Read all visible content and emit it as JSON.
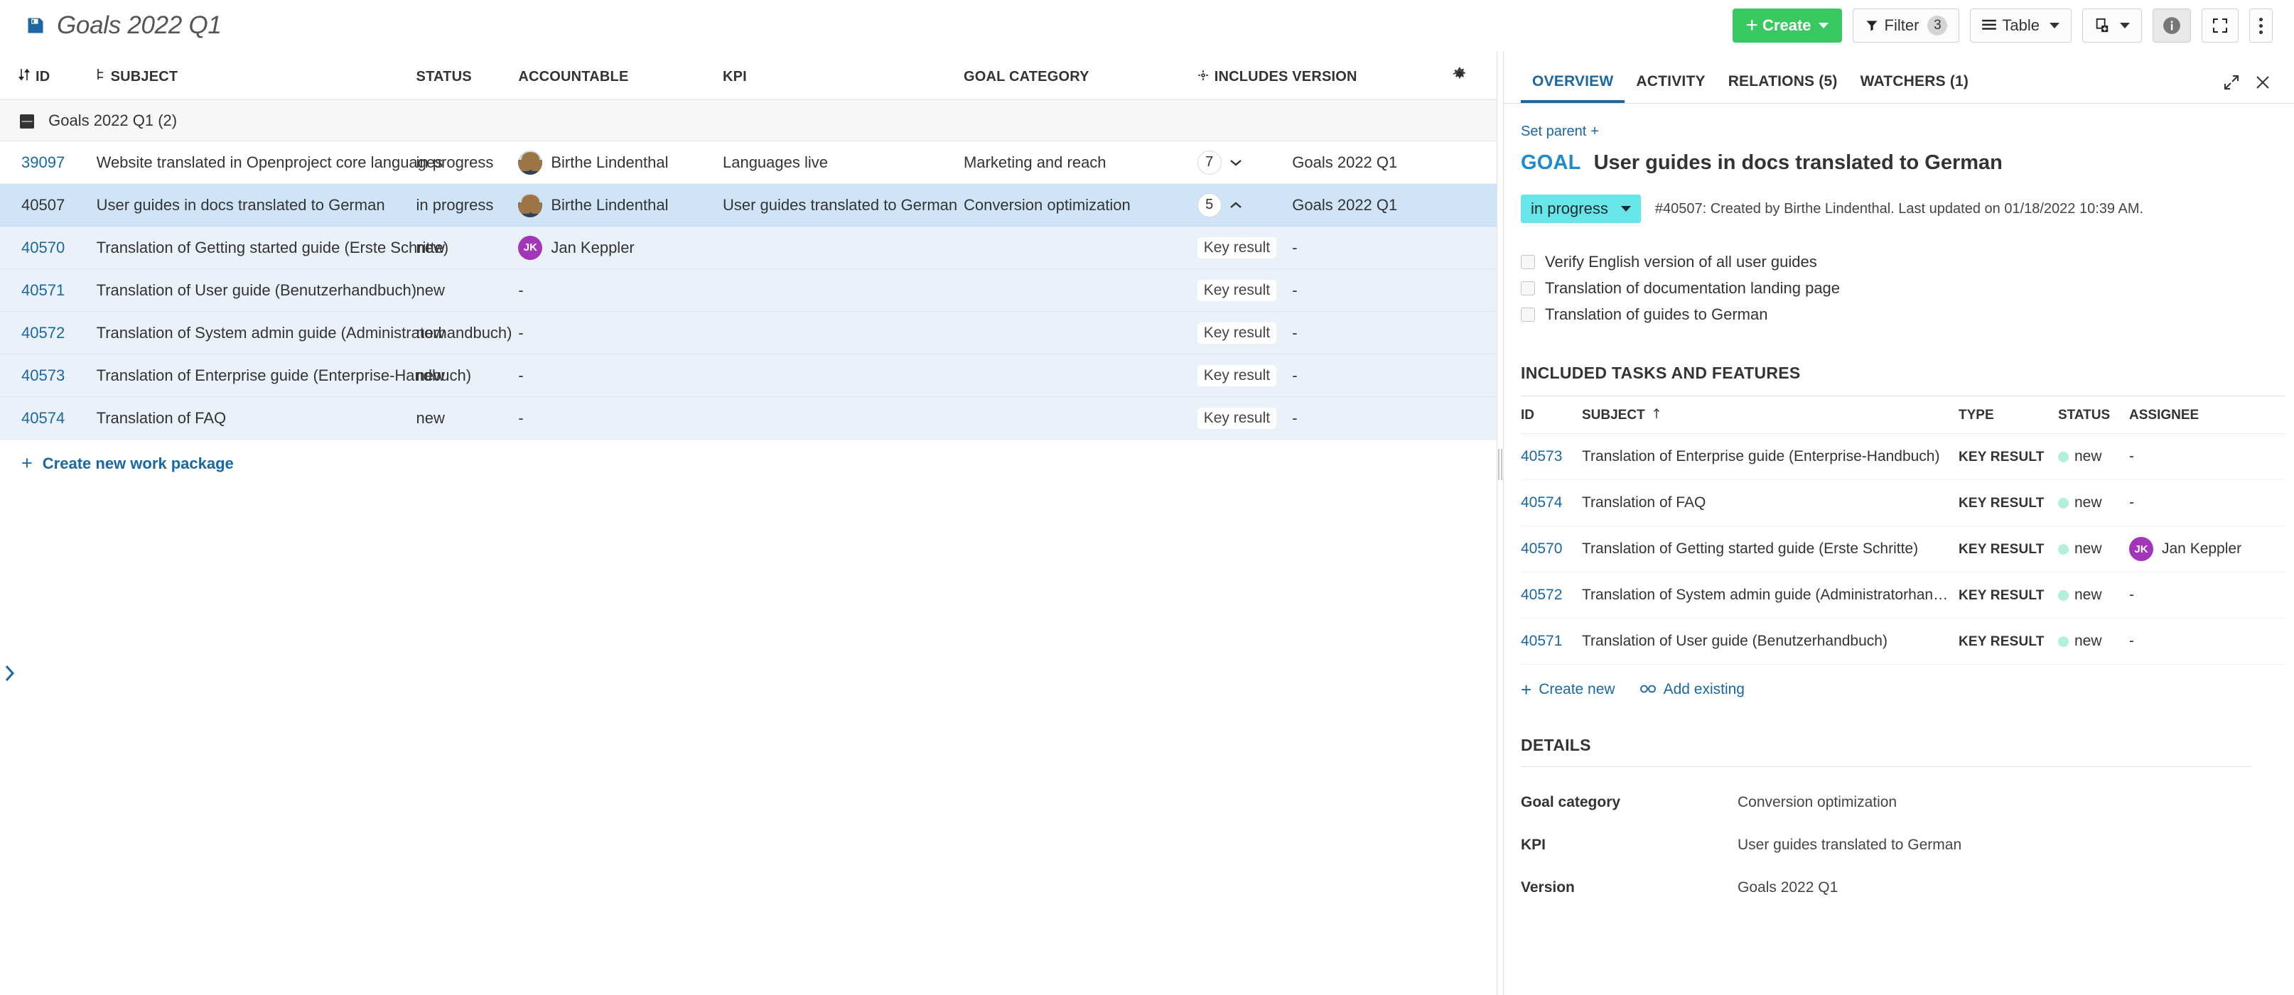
{
  "header": {
    "save_icon": "save-icon",
    "title": "Goals 2022 Q1",
    "buttons": {
      "create": "Create",
      "filter": "Filter",
      "filter_count": "3",
      "view_mode": "Table",
      "export_icon": "export-icon",
      "info_icon": "info-icon",
      "fullscreen_icon": "fullscreen-icon",
      "more_icon": "more-vertical-icon"
    }
  },
  "table": {
    "columns": [
      {
        "key": "id",
        "label": "ID",
        "icon": "sort-icon"
      },
      {
        "key": "subject",
        "label": "SUBJECT",
        "icon": "hierarchy-icon"
      },
      {
        "key": "status",
        "label": "STATUS",
        "icon": ""
      },
      {
        "key": "accountable",
        "label": "ACCOUNTABLE",
        "icon": ""
      },
      {
        "key": "kpi",
        "label": "KPI",
        "icon": ""
      },
      {
        "key": "goal_category",
        "label": "GOAL CATEGORY",
        "icon": ""
      },
      {
        "key": "includes",
        "label": "INCLUDES",
        "icon": "relations-icon"
      },
      {
        "key": "version",
        "label": "VERSION",
        "icon": ""
      },
      {
        "key": "settings",
        "label": "",
        "icon": "gear-icon"
      }
    ],
    "group": {
      "label": "Goals 2022 Q1 (2)",
      "collapse_icon": "collapse-icon"
    },
    "rows": [
      {
        "id": "39097",
        "subject": "Website translated in Openproject core languages",
        "status": "in progress",
        "accountable": "Birthe Lindenthal",
        "avatar_type": "photo",
        "kpi": "Languages live",
        "goal_category": "Marketing and reach",
        "includes_count": "7",
        "includes_expanded": false,
        "includes_badge": "",
        "version": "Goals 2022 Q1",
        "state": "normal"
      },
      {
        "id": "40507",
        "subject": "User guides in docs translated to German",
        "status": "in progress",
        "accountable": "Birthe Lindenthal",
        "avatar_type": "photo",
        "kpi": "User guides translated to German",
        "goal_category": "Conversion optimization",
        "includes_count": "5",
        "includes_expanded": true,
        "includes_badge": "",
        "version": "Goals 2022 Q1",
        "state": "selected"
      },
      {
        "id": "40570",
        "subject": "Translation of Getting started guide (Erste Schritte)",
        "status": "new",
        "accountable": "Jan Keppler",
        "avatar_type": "initials",
        "avatar_initials": "JK",
        "kpi": "",
        "goal_category": "",
        "includes_count": "",
        "includes_badge": "Key result",
        "version": "-",
        "state": "child"
      },
      {
        "id": "40571",
        "subject": "Translation of User guide (Benutzerhandbuch)",
        "status": "new",
        "accountable": "-",
        "avatar_type": "none",
        "kpi": "",
        "goal_category": "",
        "includes_count": "",
        "includes_badge": "Key result",
        "version": "-",
        "state": "child"
      },
      {
        "id": "40572",
        "subject": "Translation of System admin guide (Administratorhandbuch)",
        "status": "new",
        "accountable": "-",
        "avatar_type": "none",
        "kpi": "",
        "goal_category": "",
        "includes_count": "",
        "includes_badge": "Key result",
        "version": "-",
        "state": "child"
      },
      {
        "id": "40573",
        "subject": "Translation of Enterprise guide (Enterprise-Handbuch)",
        "status": "new",
        "accountable": "-",
        "avatar_type": "none",
        "kpi": "",
        "goal_category": "",
        "includes_count": "",
        "includes_badge": "Key result",
        "version": "-",
        "state": "child"
      },
      {
        "id": "40574",
        "subject": "Translation of FAQ",
        "status": "new",
        "accountable": "-",
        "avatar_type": "none",
        "kpi": "",
        "goal_category": "",
        "includes_count": "",
        "includes_badge": "Key result",
        "version": "-",
        "state": "child"
      }
    ],
    "create_link": "Create new work package"
  },
  "detail": {
    "tabs": [
      {
        "label": "OVERVIEW",
        "active": true
      },
      {
        "label": "ACTIVITY",
        "active": false
      },
      {
        "label": "RELATIONS (5)",
        "active": false
      },
      {
        "label": "WATCHERS (1)",
        "active": false
      }
    ],
    "expand_icon": "expand-icon",
    "close_icon": "close-icon",
    "set_parent": "Set parent",
    "type_label": "GOAL",
    "subject": "User guides in docs translated to German",
    "status": "in progress",
    "meta": "#40507: Created by Birthe Lindenthal. Last updated on 01/18/2022 10:39 AM.",
    "checklist": [
      "Verify English version of all user guides",
      "Translation of documentation landing page",
      "Translation of guides to German"
    ],
    "included_section": {
      "title": "INCLUDED TASKS AND FEATURES",
      "columns": [
        "ID",
        "SUBJECT",
        "TYPE",
        "STATUS",
        "ASSIGNEE"
      ],
      "sort_column": "SUBJECT",
      "rows": [
        {
          "id": "40573",
          "subject": "Translation of Enterprise guide (Enterprise-Handbuch)",
          "type": "KEY RESULT",
          "status": "new",
          "assignee": "-",
          "avatar": ""
        },
        {
          "id": "40574",
          "subject": "Translation of FAQ",
          "type": "KEY RESULT",
          "status": "new",
          "assignee": "-",
          "avatar": ""
        },
        {
          "id": "40570",
          "subject": "Translation of Getting started guide (Erste Schritte)",
          "type": "KEY RESULT",
          "status": "new",
          "assignee": "Jan Keppler",
          "avatar": "JK"
        },
        {
          "id": "40572",
          "subject": "Translation of System admin guide (Administratorhandbuch)",
          "type": "KEY RESULT",
          "status": "new",
          "assignee": "-",
          "avatar": ""
        },
        {
          "id": "40571",
          "subject": "Translation of User guide (Benutzerhandbuch)",
          "type": "KEY RESULT",
          "status": "new",
          "assignee": "-",
          "avatar": ""
        }
      ],
      "create_new": "Create new",
      "add_existing": "Add existing"
    },
    "details_section": {
      "title": "DETAILS",
      "fields": [
        {
          "key": "Goal category",
          "value": "Conversion optimization"
        },
        {
          "key": "KPI",
          "value": "User guides translated to German"
        },
        {
          "key": "Version",
          "value": "Goals 2022 Q1"
        }
      ]
    }
  },
  "colors": {
    "accent_blue": "#1a67a3",
    "create_green": "#38ca61",
    "status_inprogress": "#68e5e8",
    "status_new_dot": "#b3f0d9",
    "avatar_purple": "#a335b8",
    "row_selected": "#cfe5f7",
    "row_child": "#eaf1f9"
  }
}
